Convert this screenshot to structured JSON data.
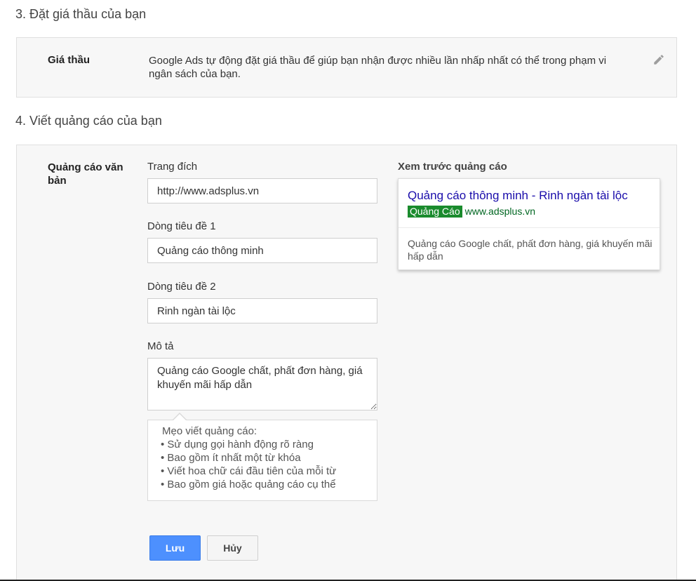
{
  "sections": {
    "bid_title": "3. Đặt giá thầu của bạn",
    "ad_title": "4. Viết quảng cáo của bạn"
  },
  "bid": {
    "label": "Giá thầu",
    "description": "Google Ads tự động đặt giá thầu để giúp bạn nhận được nhiều lần nhấp nhất có thể trong phạm vi ngân sách của bạn.",
    "edit_icon": "pencil-icon"
  },
  "ad": {
    "type_label": "Quảng cáo văn bản",
    "landing_label": "Trang đích",
    "landing_value": "http://www.adsplus.vn",
    "headline1_label": "Dòng tiêu đề 1",
    "headline1_value": "Quảng cáo thông minh",
    "headline2_label": "Dòng tiêu đề 2",
    "headline2_value": "Rinh ngàn tài lộc",
    "description_label": "Mô tả",
    "description_value": "Quảng cáo Google chất, phất đơn hàng, giá khuyến mãi hấp dẫn"
  },
  "tips": {
    "title": "Mẹo viết quảng cáo:",
    "items": [
      "Sử dụng gọi hành động rõ ràng",
      "Bao gồm ít nhất một từ khóa",
      "Viết hoa chữ cái đầu tiên của mỗi từ",
      "Bao gồm giá hoặc quảng cáo cụ thể"
    ]
  },
  "buttons": {
    "save": "Lưu",
    "cancel": "Hủy"
  },
  "preview": {
    "label": "Xem trước quảng cáo",
    "headline": "Quảng cáo thông minh - Rinh ngàn tài lộc",
    "badge": "Quảng Cáo",
    "display_url": "www.adsplus.vn",
    "description": "Quảng cáo Google chất, phất đơn hàng, giá khuyến mãi hấp dẫn"
  },
  "colors": {
    "primary_button": "#4d90fe",
    "ad_badge": "#1a8b2d",
    "headline_link": "#1a0dab",
    "display_url": "#006621"
  }
}
